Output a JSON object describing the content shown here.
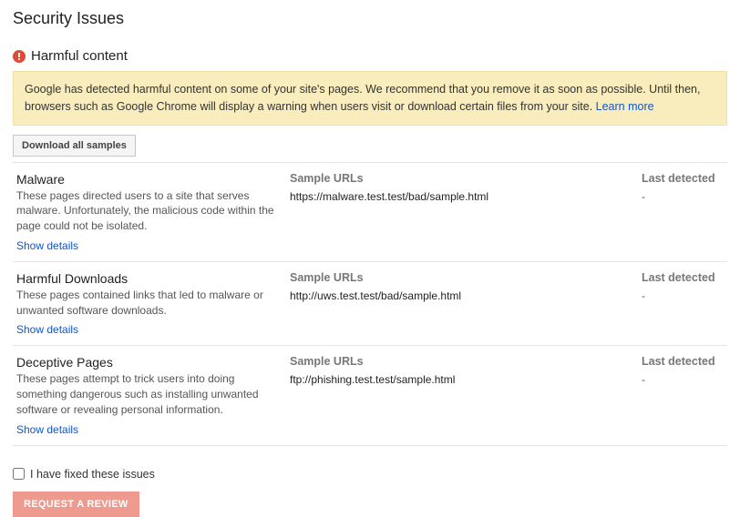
{
  "page_title": "Security Issues",
  "section": {
    "heading": "Harmful content",
    "alert_text": "Google has detected harmful content on some of your site's pages. We recommend that you remove it as soon as possible. Until then, browsers such as Google Chrome will display a warning when users visit or download certain files from your site. ",
    "learn_more": "Learn more"
  },
  "download_button": "Download all samples",
  "columns": {
    "sample_urls": "Sample URLs",
    "last_detected": "Last detected"
  },
  "issues": [
    {
      "title": "Malware",
      "description": "These pages directed users to a site that serves malware. Unfortunately, the malicious code within the page could not be isolated.",
      "sample_url": "https://malware.test.test/bad/sample.html",
      "last_detected": "-",
      "show_details": "Show details"
    },
    {
      "title": "Harmful Downloads",
      "description": "These pages contained links that led to malware or unwanted software downloads.",
      "sample_url": "http://uws.test.test/bad/sample.html",
      "last_detected": "-",
      "show_details": "Show details"
    },
    {
      "title": "Deceptive Pages",
      "description": "These pages attempt to trick users into doing something dangerous such as installing unwanted software or revealing personal information.",
      "sample_url": "ftp://phishing.test.test/sample.html",
      "last_detected": "-",
      "show_details": "Show details"
    }
  ],
  "footer": {
    "checkbox_label": "I have fixed these issues",
    "review_button": "REQUEST A REVIEW"
  }
}
